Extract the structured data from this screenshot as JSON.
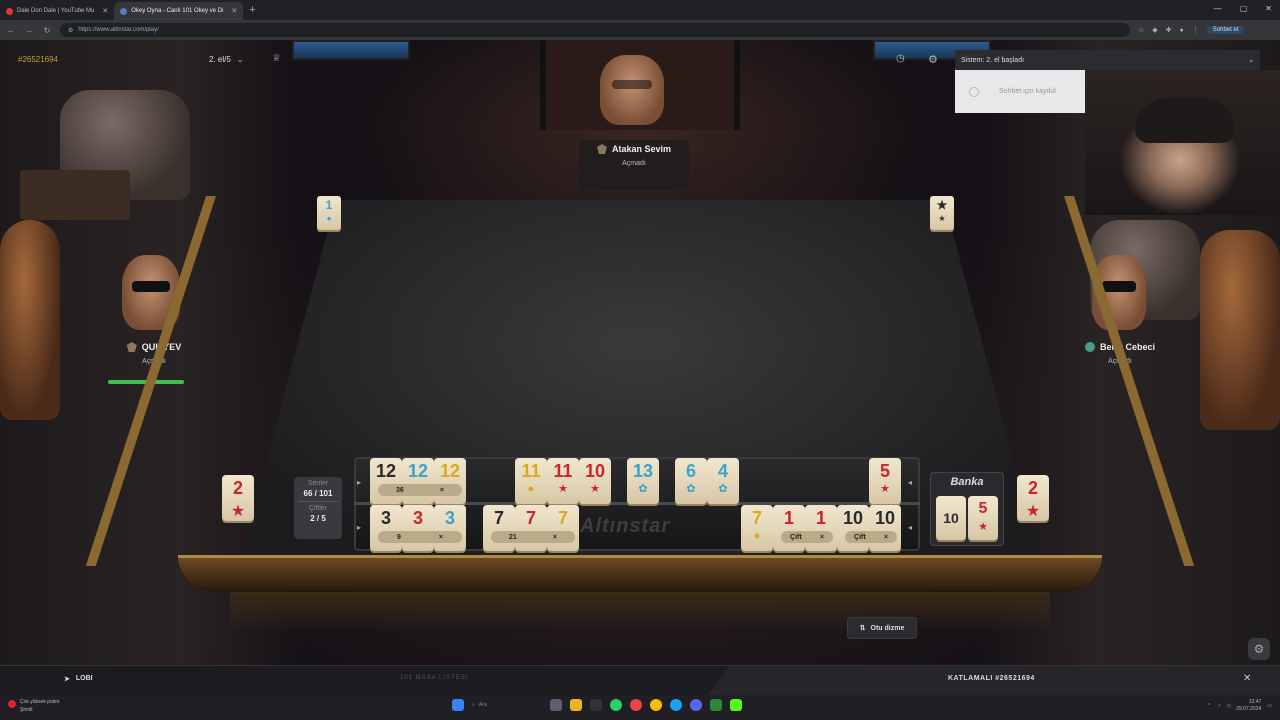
{
  "browser": {
    "tabs": [
      {
        "label": "Dale Don Dale | YouTube Mu",
        "active": false
      },
      {
        "label": "Okey Oyna - Canlı 101 Okey ve Di",
        "active": true
      }
    ],
    "url": "https://www.altinstar.com/play/",
    "extension_label": "Sohbet et"
  },
  "hud": {
    "game_id": "#26521694",
    "round": "2. el/5"
  },
  "chat": {
    "system_message": "Sistem: 2. el başladı",
    "input_placeholder": "Sohbet için kaydol"
  },
  "players": {
    "top": {
      "name": "Atakan Sevim",
      "status": "Açmadı"
    },
    "left": {
      "name": "QULIYEV",
      "status": "Açmadı",
      "timer_fraction": 1.0
    },
    "right": {
      "name": "Berat Cebeci",
      "status": "Açmadı"
    }
  },
  "table": {
    "corner_tiles": [
      {
        "position": "top-left",
        "number": "1",
        "color": "blue",
        "mark": "dot"
      },
      {
        "position": "top-right",
        "number": "★",
        "color": "black",
        "mark": "star"
      }
    ],
    "side_tiles": [
      {
        "position": "left",
        "number": "2",
        "color": "red"
      },
      {
        "position": "right",
        "number": "2",
        "color": "red"
      }
    ]
  },
  "series_panel": {
    "series_label": "Seriler",
    "series_value": "66 / 101",
    "pairs_label": "Çiftler",
    "pairs_value": "2 / 5"
  },
  "rack": {
    "logo": "Altınstar",
    "top_row": [
      {
        "number": "12",
        "color": "black"
      },
      {
        "number": "12",
        "color": "blue"
      },
      {
        "number": "12",
        "color": "yellow"
      },
      {
        "number": "11",
        "color": "yellow"
      },
      {
        "number": "11",
        "color": "red"
      },
      {
        "number": "10",
        "color": "red"
      },
      {
        "number": "13",
        "color": "blue"
      },
      {
        "number": "6",
        "color": "blue"
      },
      {
        "number": "4",
        "color": "blue"
      },
      {
        "number": "5",
        "color": "red"
      }
    ],
    "bottom_row": [
      {
        "number": "3",
        "color": "black"
      },
      {
        "number": "3",
        "color": "red"
      },
      {
        "number": "3",
        "color": "blue"
      },
      {
        "number": "7",
        "color": "black"
      },
      {
        "number": "7",
        "color": "red"
      },
      {
        "number": "7",
        "color": "yellow"
      },
      {
        "number": "7",
        "color": "yellow"
      },
      {
        "number": "1",
        "color": "red"
      },
      {
        "number": "1",
        "color": "red"
      },
      {
        "number": "10",
        "color": "black"
      },
      {
        "number": "10",
        "color": "black"
      }
    ],
    "group_labels": {
      "top_group1_sum": "36",
      "bottom_group1_sum": "9",
      "bottom_group2_sum": "21",
      "pair1": "Çift",
      "pair2": "Çift",
      "remove": "×"
    }
  },
  "bank": {
    "title": "Banka",
    "tiles": [
      {
        "number": "10",
        "color": "black"
      },
      {
        "number": "5",
        "color": "red"
      }
    ]
  },
  "buttons": {
    "auto_sort": "Otu dizme",
    "lobby": "LOBI",
    "table_list": "101 MASA LISTESI",
    "game_title": "KATLAMALI #26521694"
  },
  "taskbar": {
    "weather_line1": "Çok yüksek polen",
    "weather_line2": "Şimdi",
    "search_placeholder": "Ara",
    "time": "12:47",
    "date": "29.07.2024"
  },
  "colors": {
    "red": "#c8252e",
    "blue": "#3aa3c9",
    "yellow": "#d8aa22",
    "black": "#2a2a2a",
    "accent_gold": "#c99a3c"
  }
}
